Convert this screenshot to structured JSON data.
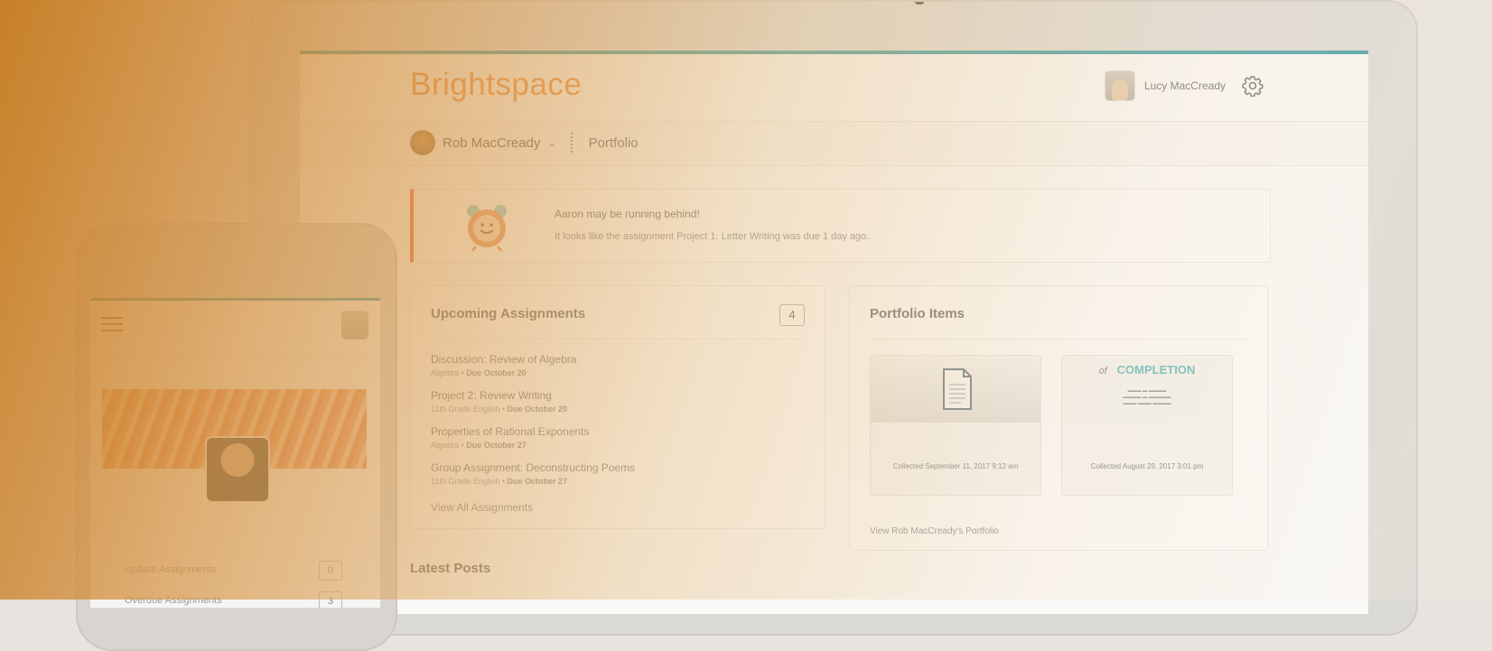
{
  "brand": "Brightspace",
  "user": {
    "name": "Lucy MacCready"
  },
  "nav": {
    "student_name": "Rob MacCready",
    "section": "Portfolio"
  },
  "alert": {
    "title": "Aaron may be running behind!",
    "text": "It looks like the assignment Project 1: Letter Writing was due 1 day ago."
  },
  "upcoming": {
    "title": "Upcoming Assignments",
    "count": "4",
    "items": [
      {
        "title": "Discussion: Review of Algebra",
        "course": "Algebra",
        "due": "Due October 20"
      },
      {
        "title": "Project 2: Review Writing",
        "course": "11th Grade English",
        "due": "Due October 20"
      },
      {
        "title": "Properties of Rational Exponents",
        "course": "Algebra",
        "due": "Due October 27"
      },
      {
        "title": "Group Assignment: Deconstructing Poems",
        "course": "11th Grade English",
        "due": "Due October 27"
      }
    ],
    "view_all": "View All Assignments"
  },
  "portfolio": {
    "title": "Portfolio Items",
    "items": [
      {
        "caption": "Collected September 11, 2017 9:12 am"
      },
      {
        "caption": "Collected August 29, 2017 3:01 pm",
        "cert_of": "of",
        "cert_title": "COMPLETION"
      }
    ],
    "view_link": "View Rob MacCready's Portfolio"
  },
  "latest_posts": {
    "title": "Latest Posts"
  },
  "phone": {
    "rows": [
      {
        "label": "Update Assignments",
        "count": "0"
      },
      {
        "label": "Overdue Assignments",
        "count": "3"
      }
    ]
  },
  "colors": {
    "brand": "#ef8b3a",
    "accent": "#3a9aa0",
    "alert": "#e06a3b",
    "overlay": "#c67c20"
  }
}
